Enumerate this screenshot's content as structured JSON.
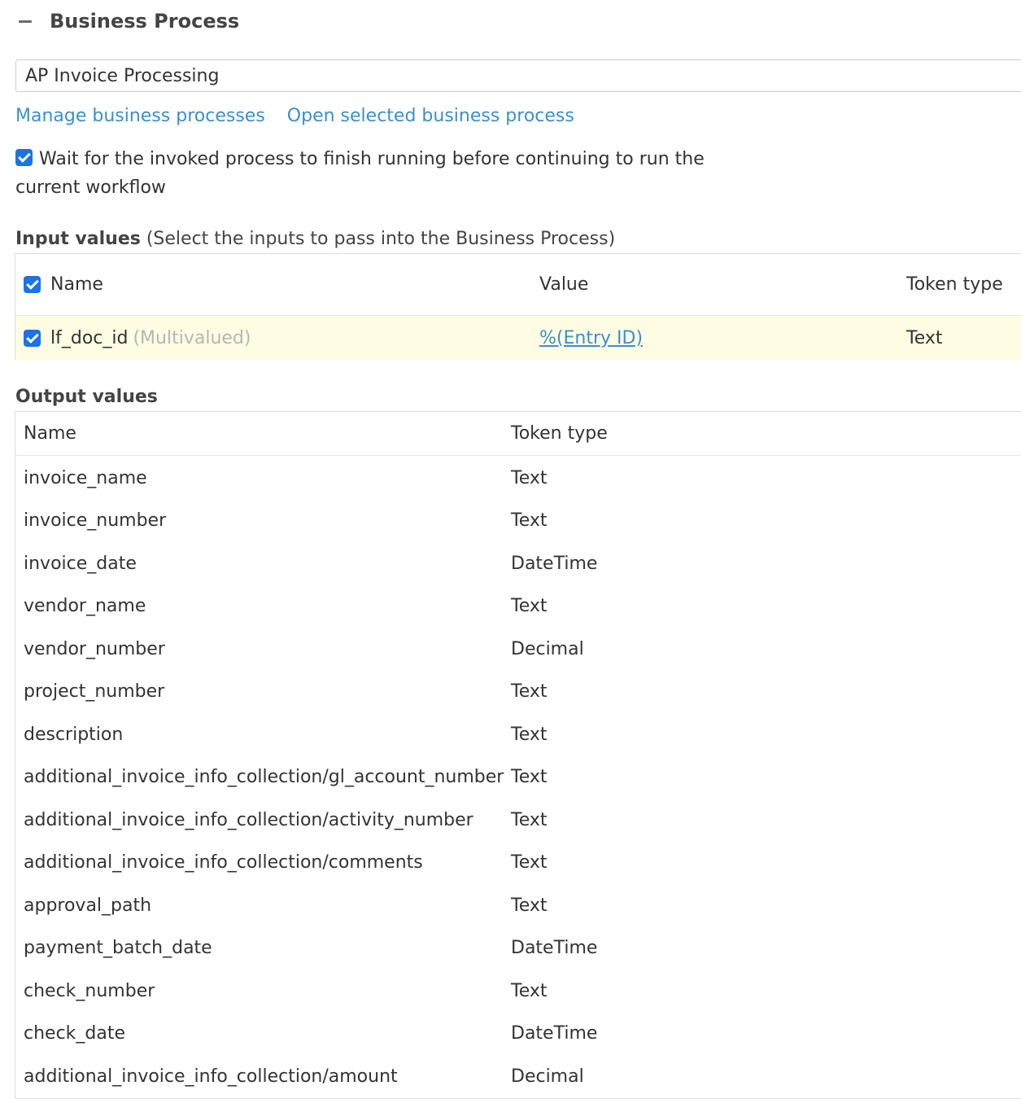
{
  "section": {
    "title": "Business Process"
  },
  "process_select": {
    "value": "AP Invoice Processing"
  },
  "links": {
    "manage": "Manage business processes",
    "open": "Open selected business process"
  },
  "wait_option": {
    "label": "Wait for the invoked process to finish running before continuing to run the current workflow",
    "checked": true
  },
  "input_values": {
    "heading": "Input values",
    "subheading": "(Select the inputs to pass into the Business Process)",
    "columns": {
      "name": "Name",
      "value": "Value",
      "token_type": "Token type"
    },
    "rows": [
      {
        "name": "lf_doc_id",
        "note": "(Multivalued)",
        "value": "%(Entry ID)",
        "token_type": "Text",
        "checked": true
      }
    ]
  },
  "output_values": {
    "heading": "Output values",
    "columns": {
      "name": "Name",
      "token_type": "Token type"
    },
    "rows": [
      {
        "name": "invoice_name",
        "token_type": "Text"
      },
      {
        "name": "invoice_number",
        "token_type": "Text"
      },
      {
        "name": "invoice_date",
        "token_type": "DateTime"
      },
      {
        "name": "vendor_name",
        "token_type": "Text"
      },
      {
        "name": "vendor_number",
        "token_type": "Decimal"
      },
      {
        "name": "project_number",
        "token_type": "Text"
      },
      {
        "name": "description",
        "token_type": "Text"
      },
      {
        "name": "additional_invoice_info_collection/gl_account_number",
        "token_type": "Text"
      },
      {
        "name": "additional_invoice_info_collection/activity_number",
        "token_type": "Text"
      },
      {
        "name": "additional_invoice_info_collection/comments",
        "token_type": "Text"
      },
      {
        "name": "approval_path",
        "token_type": "Text"
      },
      {
        "name": "payment_batch_date",
        "token_type": "DateTime"
      },
      {
        "name": "check_number",
        "token_type": "Text"
      },
      {
        "name": "check_date",
        "token_type": "DateTime"
      },
      {
        "name": "additional_invoice_info_collection/amount",
        "token_type": "Decimal"
      }
    ]
  },
  "colors": {
    "link": "#3a8fcf",
    "checkbox": "#1a73e8",
    "highlight_row": "#fefde4"
  }
}
